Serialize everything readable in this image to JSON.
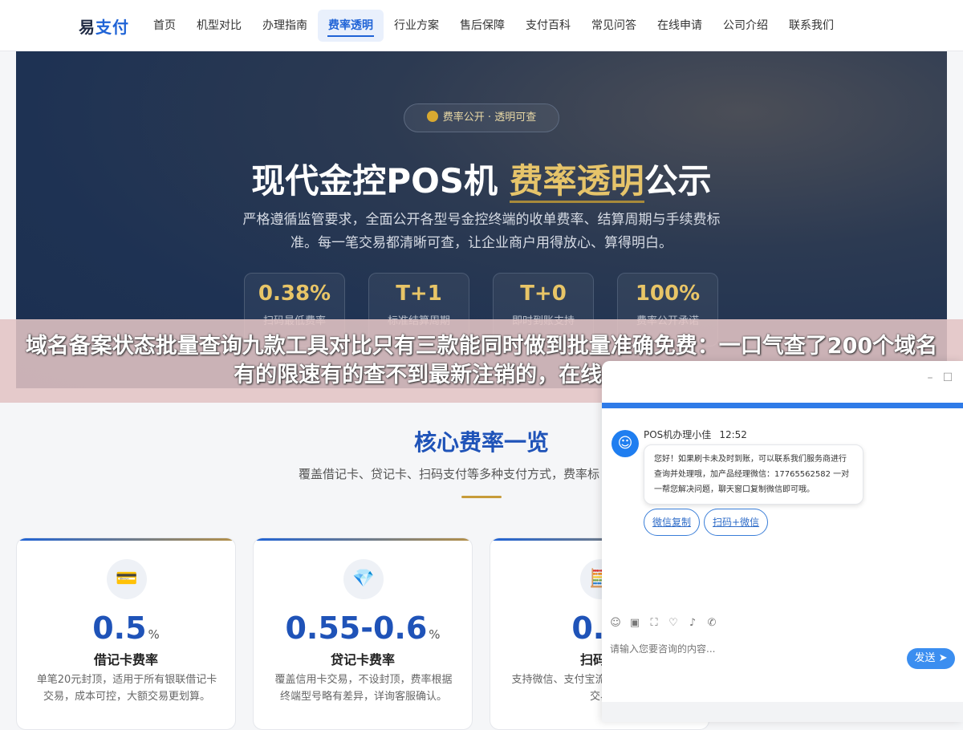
{
  "logo": {
    "part1": "易",
    "part2": "支付"
  },
  "nav": {
    "items": [
      {
        "label": "首页"
      },
      {
        "label": "机型对比"
      },
      {
        "label": "办理指南"
      },
      {
        "label": "费率透明",
        "active": true
      },
      {
        "label": "行业方案"
      },
      {
        "label": "售后保障"
      },
      {
        "label": "支付百科"
      },
      {
        "label": "常见问答"
      },
      {
        "label": "在线申请"
      },
      {
        "label": "公司介绍"
      },
      {
        "label": "联系我们"
      }
    ]
  },
  "hero": {
    "badge": "费率公开 · 透明可查",
    "title_pre": "现代金控POS机 ",
    "title_highlight": "费率透明",
    "title_post": "公示",
    "desc": "严格遵循监管要求，全面公开各型号金控终端的收单费率、结算周期与手续费标准。每一笔交易都清晰可查，让企业商户用得放心、算得明白。",
    "stats": [
      {
        "value": "0.38%",
        "label": "扫码最低费率"
      },
      {
        "value": "T+1",
        "label": "标准结算周期"
      },
      {
        "value": "T+0",
        "label": "即时到账支持"
      },
      {
        "value": "100%",
        "label": "费率公开承诺"
      }
    ]
  },
  "banner": {
    "text": "域名备案状态批量查询九款工具对比只有三款能同时做到批量准确免费：一口气查了200个域名有的限速有的查不到最新注销的，在线桌面API自建"
  },
  "rates": {
    "title": "核心费率一览",
    "subtitle": "覆盖借记卡、贷记卡、扫码支付等多种支付方式，费率标",
    "cards": [
      {
        "icon": "credit-card-icon",
        "glyph": "💳",
        "value": "0.5",
        "unit": "%",
        "name": "借记卡费率",
        "desc": "单笔20元封顶，适用于所有银联借记卡交易，成本可控，大额交易更划算。"
      },
      {
        "icon": "diamond-icon",
        "glyph": "💎",
        "value": "0.55-0.6",
        "unit": "%",
        "name": "贷记卡费率",
        "desc": "覆盖信用卡交易，不设封顶，费率根据终端型号略有差异，详询客服确认。"
      },
      {
        "icon": "calculator-icon",
        "glyph": "🧮",
        "value": "0.3",
        "unit": "",
        "name": "扫码支",
        "desc": "支持微信、支付宝流扫码方式，费率频交易"
      }
    ]
  },
  "chat": {
    "agent_name": "POS机办理小佳",
    "time": "12:52",
    "message": "您好！如果刷卡未及时到账，可以联系我们服务商进行查询并处理哦，加产品经理微信：17765562582 一对一帮您解决问题，聊天窗口复制微信即可哦。",
    "quick_replies": [
      "微信复制",
      "扫码+微信"
    ],
    "input_placeholder": "请输入您要咨询的内容...",
    "send_label": "发送",
    "accent": "#2f7be8"
  }
}
